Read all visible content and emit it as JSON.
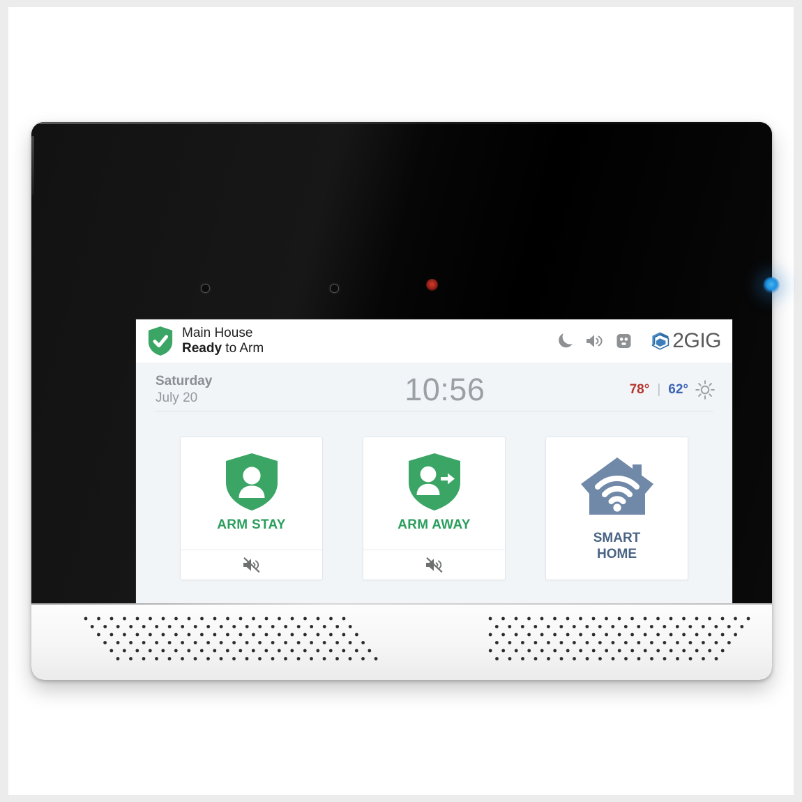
{
  "device": {
    "name": "2GIG security touchscreen panel",
    "top_bezel": {
      "sensors": [
        "ambient-light-sensor",
        "proximity-sensor"
      ],
      "led_red": "status-led-red",
      "led_blue": "status-led-blue",
      "led_red_color": "#c7362a",
      "led_blue_color": "#2a9fe4"
    },
    "speaker_grilles": [
      "left-speaker-grille",
      "right-speaker-grille"
    ]
  },
  "screen": {
    "header": {
      "shield_icon": "shield-check-icon",
      "shield_color": "#3aa564",
      "site_name": "Main House",
      "status_bold": "Ready",
      "status_rest": " to Arm",
      "icons": [
        {
          "name": "moon-icon",
          "label": "Night Mode"
        },
        {
          "name": "speaker-volume-icon",
          "label": "Volume"
        },
        {
          "name": "power-outlet-icon",
          "label": "AC Power"
        }
      ],
      "brand": {
        "logo_icon": "2gig-cube-logo-icon",
        "text": "2GIG",
        "logo_color": "#2f6fa8",
        "text_color": "#5a5a5a"
      }
    },
    "datetime": {
      "weekday": "Saturday",
      "month_day": "July 20",
      "time": "10:56",
      "temp_high": "78°",
      "temp_separator": "|",
      "temp_low": "62°",
      "temp_high_color": "#b5342c",
      "temp_low_color": "#3b62b5",
      "weather_icon": "sun-icon"
    },
    "tiles": [
      {
        "id": "arm-stay",
        "label": "ARM STAY",
        "icon": "shield-person-icon",
        "color": "#2a9e5d",
        "footer_icon": "speaker-muted-icon",
        "footer_icon_label": "Silent Arming"
      },
      {
        "id": "arm-away",
        "label": "ARM AWAY",
        "icon": "shield-person-arrow-icon",
        "color": "#2a9e5d",
        "footer_icon": "speaker-muted-icon",
        "footer_icon_label": "Silent Arming"
      },
      {
        "id": "smart-home",
        "label_line1": "SMART",
        "label_line2": "HOME",
        "icon": "house-wifi-icon",
        "color": "#4a6484",
        "icon_color": "#7089a8"
      }
    ],
    "toolbar": {
      "emergency_icon": "emergency-asterisk-icon",
      "emergency_color": "#e04b45",
      "keypad_icon": "keypad-grid-icon",
      "settings_icon": "gear-icon",
      "icon_color": "#8a8a8a"
    }
  }
}
